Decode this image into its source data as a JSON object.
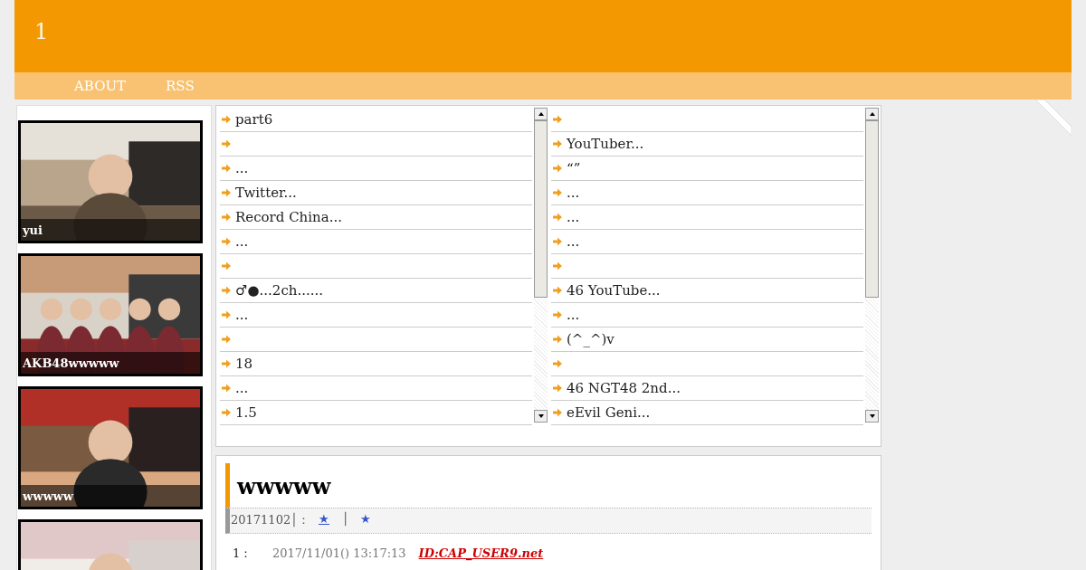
{
  "site": {
    "title": "1"
  },
  "nav": [
    {
      "label": "ABOUT"
    },
    {
      "label": "RSS"
    }
  ],
  "sidebar": {
    "cards": [
      {
        "caption": "yui",
        "kind": "picture"
      },
      {
        "caption": "AKB48wwwww",
        "kind": "picture"
      },
      {
        "caption": "wwwww",
        "kind": "picture"
      },
      {
        "kind": "picture"
      }
    ]
  },
  "lists": [
    {
      "items": [
        {
          "text": " part6"
        },
        {
          "kind": "blank"
        },
        {
          "text": "..."
        },
        {
          "text": "Twitter..."
        },
        {
          "text": "Record China..."
        },
        {
          "text": "..."
        },
        {
          "kind": "blank"
        },
        {
          "text": "♂●...2ch......"
        },
        {
          "text": "..."
        },
        {
          "kind": "blank"
        },
        {
          "text": "18"
        },
        {
          "text": "..."
        },
        {
          "text": "1.5"
        }
      ]
    },
    {
      "items": [
        {
          "kind": "blank"
        },
        {
          "text": "YouTuber..."
        },
        {
          "text": "“”"
        },
        {
          "text": "..."
        },
        {
          "text": "..."
        },
        {
          "text": "..."
        },
        {
          "kind": "blank"
        },
        {
          "text": "46 YouTube..."
        },
        {
          "text": "..."
        },
        {
          "text": "(^_^)v"
        },
        {
          "kind": "blank"
        },
        {
          "text": "46 NGT48 2nd..."
        },
        {
          "text": "eEvil Geni..."
        }
      ]
    }
  ],
  "article": {
    "title": "wwwww",
    "meta": [
      {
        "kind": "text",
        "text": "20171102│："
      },
      {
        "kind": "link",
        "text": "★"
      },
      {
        "kind": "text",
        "text": "│"
      },
      {
        "kind": "star",
        "text": "★"
      }
    ],
    "comment": {
      "number": "1：",
      "date": "2017/11/01() 13:17:13",
      "id": "ID:CAP_USER9.net"
    }
  }
}
